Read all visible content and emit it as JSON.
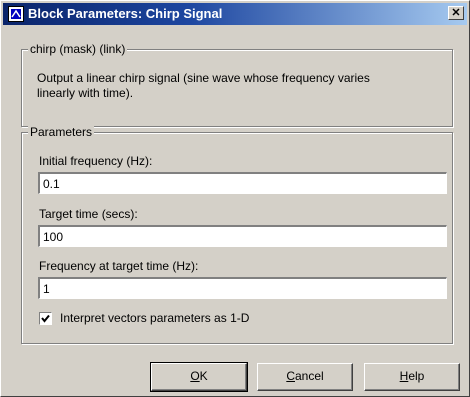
{
  "window": {
    "title": "Block Parameters: Chirp Signal"
  },
  "mask_group": {
    "label": "chirp (mask) (link)",
    "description": "Output a linear chirp signal (sine wave  whose frequency varies\nlinearly with time)."
  },
  "params_group": {
    "label": "Parameters",
    "initial_frequency": {
      "label": "Initial frequency (Hz):",
      "value": "0.1"
    },
    "target_time": {
      "label": "Target time (secs):",
      "value": "100"
    },
    "freq_at_target": {
      "label": "Frequency at target time (Hz):",
      "value": "1"
    },
    "interpret_vectors": {
      "label": "Interpret vectors parameters as 1-D",
      "checked": true
    }
  },
  "buttons": {
    "ok": {
      "mnemonic": "O",
      "rest": "K"
    },
    "cancel": {
      "mnemonic": "C",
      "rest": "ancel"
    },
    "help": {
      "mnemonic": "H",
      "rest": "elp"
    }
  },
  "colors": {
    "title_bar_start": "#0a246a",
    "title_bar_end": "#a6caf0",
    "face": "#d4d0c8"
  }
}
